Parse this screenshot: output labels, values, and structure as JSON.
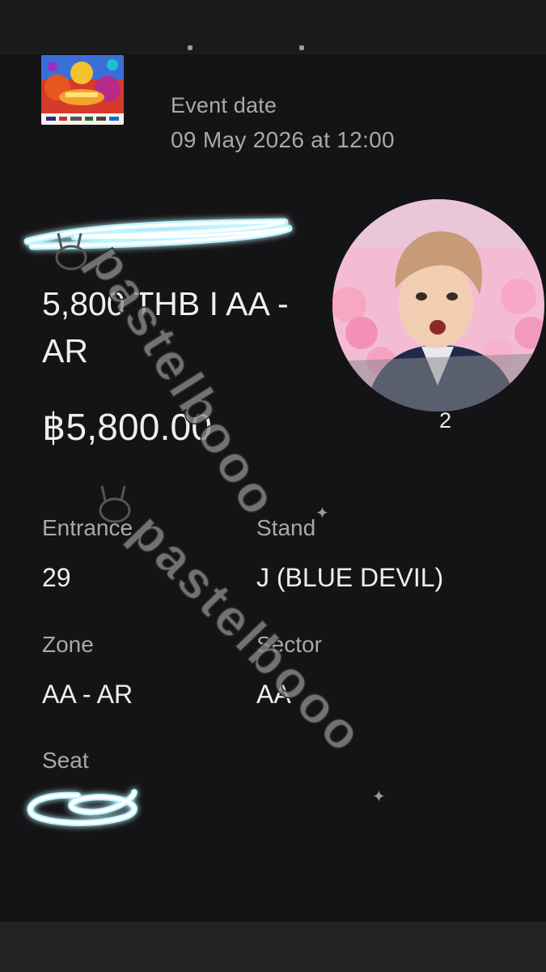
{
  "event": {
    "date_label": "Event date",
    "date_value": "09 May 2026 at 12:00"
  },
  "ticket": {
    "name": "5,800 THB I AA - AR",
    "price": "฿5,800.00",
    "quantity": "2"
  },
  "fields": {
    "entrance": {
      "label": "Entrance",
      "value": "29"
    },
    "stand": {
      "label": "Stand",
      "value": "J (BLUE DEVIL)"
    },
    "zone": {
      "label": "Zone",
      "value": "AA - AR"
    },
    "sector": {
      "label": "Sector",
      "value": "AA"
    },
    "seat": {
      "label": "Seat"
    }
  },
  "watermark": {
    "text": "pastelbooo"
  },
  "colors": {
    "background": "#141416",
    "muted_text": "#a9a9ab",
    "primary_text": "#eeeeee",
    "scribble_glow": "#bff5ff"
  }
}
